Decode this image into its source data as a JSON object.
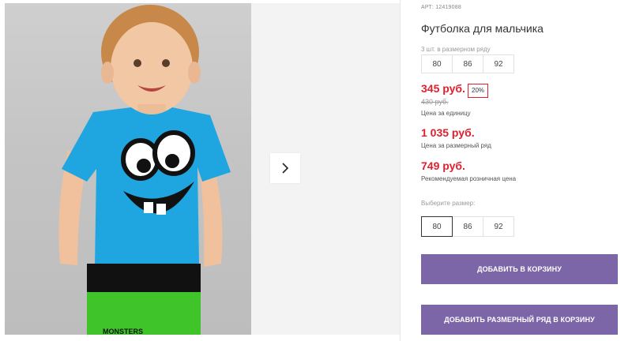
{
  "product": {
    "article": "АРТ: 12419088",
    "title": "Футболка для мальчика",
    "set_label": "3 шт. в размерном ряду",
    "set_sizes": [
      "80",
      "86",
      "92"
    ],
    "price": "345 руб.",
    "discount": "20%",
    "old_price": "430 руб.",
    "price_caption": "Цена за единицу",
    "set_price": "1 035 руб.",
    "set_price_caption": "Цена за размерный ряд",
    "rrp": "749 руб.",
    "rrp_caption": "Рекомендуемая розничная цена",
    "choose_size_label": "Выберите размер:",
    "size_options": [
      "80",
      "86",
      "92"
    ],
    "selected_size": "80",
    "shirt_print_text": "MONSTERS"
  },
  "buttons": {
    "add_to_cart": "ДОБАВИТЬ В КОРЗИНУ",
    "add_set_to_cart": "ДОБАВИТЬ РАЗМЕРНЫЙ РЯД В КОРЗИНУ"
  },
  "gallery": {
    "next_icon": "chevron-right-icon"
  },
  "colors": {
    "price_red": "#e0202e",
    "button_purple": "#7c66a8",
    "shirt_blue": "#1fa6e0",
    "shorts_green": "#3fc52a"
  }
}
